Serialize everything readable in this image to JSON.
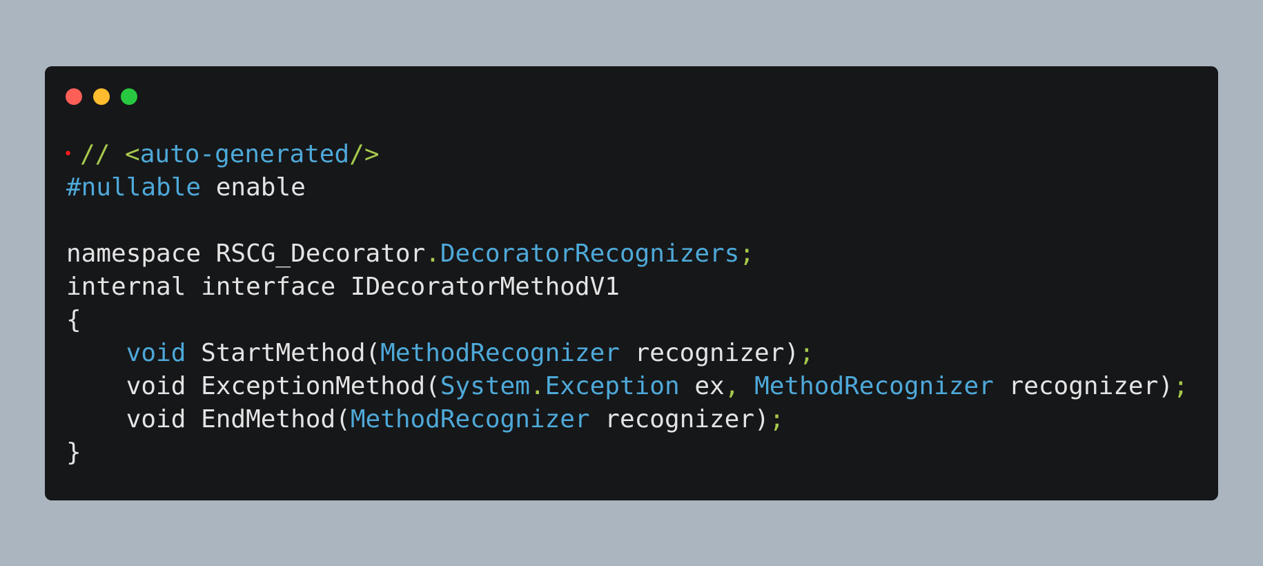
{
  "colors": {
    "background": "#abb5c0",
    "window": "#161719",
    "text": "#e4e4e4",
    "keyword": "#4ea9d9",
    "punctuation": "#a7c94c",
    "marker": "#ff1a1a"
  },
  "window_controls": [
    {
      "name": "close-dot",
      "color": "#fe5f57"
    },
    {
      "name": "minimize-dot",
      "color": "#febc2e"
    },
    {
      "name": "maximize-dot",
      "color": "#28c840"
    }
  ],
  "code": {
    "marker": "•",
    "lines": [
      [
        {
          "text": "// ",
          "color": "#a7c94c"
        },
        {
          "text": "<",
          "color": "#a7c94c"
        },
        {
          "text": "auto-generated",
          "color": "#4ea9d9"
        },
        {
          "text": "/>",
          "color": "#a7c94c"
        }
      ],
      [
        {
          "text": "#nullable",
          "color": "#4ea9d9"
        },
        {
          "text": " enable",
          "color": "#e4e4e4"
        }
      ],
      [],
      [
        {
          "text": "namespace RSCG_Decorator",
          "color": "#e4e4e4"
        },
        {
          "text": ".",
          "color": "#a7c94c"
        },
        {
          "text": "DecoratorRecognizers",
          "color": "#4ea9d9"
        },
        {
          "text": ";",
          "color": "#a7c94c"
        }
      ],
      [
        {
          "text": "internal interface IDecoratorMethodV1",
          "color": "#e4e4e4"
        }
      ],
      [
        {
          "text": "{",
          "color": "#e4e4e4"
        }
      ],
      [
        {
          "text": "    ",
          "color": "#e4e4e4"
        },
        {
          "text": "void",
          "color": "#4ea9d9"
        },
        {
          "text": " StartMethod(",
          "color": "#e4e4e4"
        },
        {
          "text": "MethodRecognizer",
          "color": "#4ea9d9"
        },
        {
          "text": " recognizer)",
          "color": "#e4e4e4"
        },
        {
          "text": ";",
          "color": "#a7c94c"
        }
      ],
      [
        {
          "text": "    void ExceptionMethod(",
          "color": "#e4e4e4"
        },
        {
          "text": "System",
          "color": "#4ea9d9"
        },
        {
          "text": ".",
          "color": "#a7c94c"
        },
        {
          "text": "Exception",
          "color": "#4ea9d9"
        },
        {
          "text": " ex",
          "color": "#e4e4e4"
        },
        {
          "text": ",",
          "color": "#a7c94c"
        },
        {
          "text": " ",
          "color": "#e4e4e4"
        },
        {
          "text": "MethodRecognizer",
          "color": "#4ea9d9"
        },
        {
          "text": " recognizer)",
          "color": "#e4e4e4"
        },
        {
          "text": ";",
          "color": "#a7c94c"
        }
      ],
      [
        {
          "text": "    void EndMethod(",
          "color": "#e4e4e4"
        },
        {
          "text": "MethodRecognizer",
          "color": "#4ea9d9"
        },
        {
          "text": " recognizer)",
          "color": "#e4e4e4"
        },
        {
          "text": ";",
          "color": "#a7c94c"
        }
      ],
      [
        {
          "text": "}",
          "color": "#e4e4e4"
        }
      ]
    ]
  }
}
